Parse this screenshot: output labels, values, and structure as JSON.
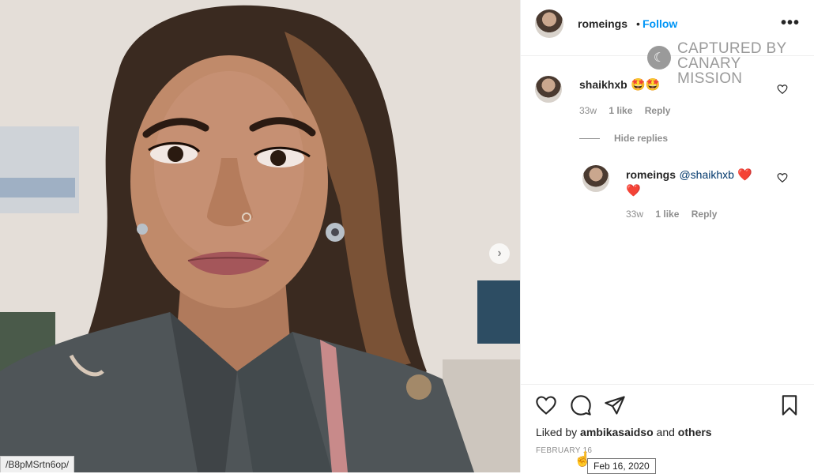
{
  "photo": {
    "next_icon": "chevron-right-icon",
    "url_tooltip": "/B8pMSrtn6op/"
  },
  "header": {
    "username": "romeings",
    "separator": "•",
    "follow_label": "Follow",
    "more_icon": "more-horizontal-icon"
  },
  "watermark": {
    "line1": "CAPTURED BY",
    "line2": "CANARY MISSION"
  },
  "comments": [
    {
      "username": "shaikhxb",
      "text": "🤩🤩",
      "time": "33w",
      "likes": "1 like",
      "reply_label": "Reply"
    }
  ],
  "hide_replies_label": "Hide replies",
  "replies": [
    {
      "username": "romeings",
      "mention": "@shaikhxb",
      "text": "❤️",
      "text2": "❤️",
      "time": "33w",
      "likes": "1 like",
      "reply_label": "Reply"
    }
  ],
  "footer": {
    "liked_prefix": "Liked by",
    "liked_user": "ambikasaidso",
    "liked_and": "and",
    "liked_others": "others",
    "date": "FEBRUARY 16",
    "date_tooltip": "Feb 16, 2020"
  }
}
